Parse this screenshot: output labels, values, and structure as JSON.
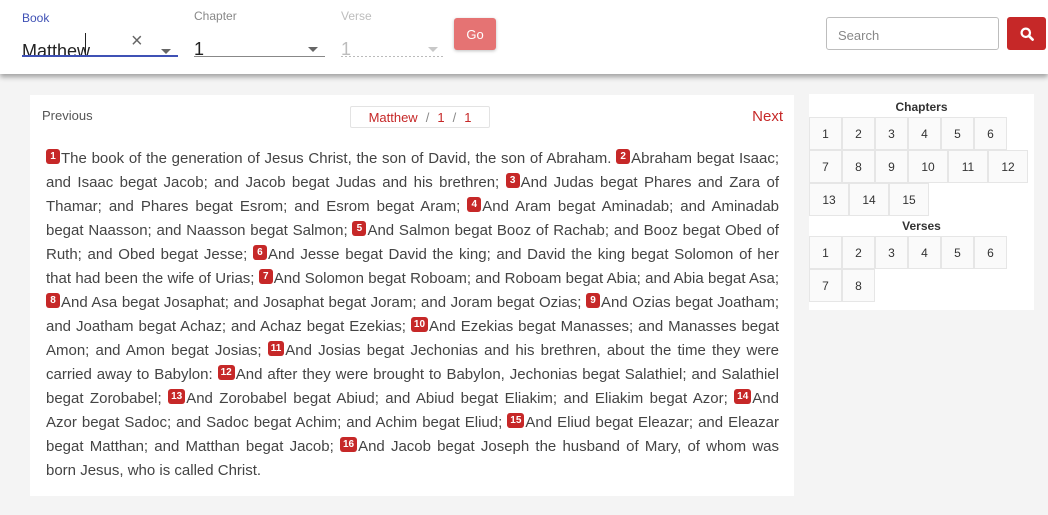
{
  "book_field": {
    "label": "Book",
    "value": "Matthew"
  },
  "chapter_field": {
    "label": "Chapter",
    "value": "1"
  },
  "verse_field": {
    "label": "Verse",
    "value": "1"
  },
  "go_label": "Go",
  "search": {
    "placeholder": "Search"
  },
  "nav": {
    "previous": "Previous",
    "next": "Next",
    "crumb": {
      "book": "Matthew",
      "sep1": "/",
      "chapter": "1",
      "sep2": "/",
      "verse": "1"
    }
  },
  "verses": [
    {
      "n": "1",
      "text": "The book of the generation of Jesus Christ, the son of David, the son of Abraham."
    },
    {
      "n": "2",
      "text": "Abraham begat Isaac; and Isaac begat Jacob; and Jacob begat Judas and his brethren;"
    },
    {
      "n": "3",
      "text": "And Judas begat Phares and Zara of Thamar; and Phares begat Esrom; and Esrom begat Aram;"
    },
    {
      "n": "4",
      "text": "And Aram begat Aminadab; and Aminadab begat Naasson; and Naasson begat Salmon;"
    },
    {
      "n": "5",
      "text": "And Salmon begat Booz of Rachab; and Booz begat Obed of Ruth; and Obed begat Jesse;"
    },
    {
      "n": "6",
      "text": "And Jesse begat David the king; and David the king begat Solomon of her that had been the wife of Urias;"
    },
    {
      "n": "7",
      "text": "And Solomon begat Roboam; and Roboam begat Abia; and Abia begat Asa;"
    },
    {
      "n": "8",
      "text": "And Asa begat Josaphat; and Josaphat begat Joram; and Joram begat Ozias;"
    },
    {
      "n": "9",
      "text": "And Ozias begat Joatham; and Joatham begat Achaz; and Achaz begat Ezekias;"
    },
    {
      "n": "10",
      "text": "And Ezekias begat Manasses; and Manasses begat Amon; and Amon begat Josias;"
    },
    {
      "n": "11",
      "text": "And Josias begat Jechonias and his brethren, about the time they were carried away to Babylon:"
    },
    {
      "n": "12",
      "text": "And after they were brought to Babylon, Jechonias begat Salathiel; and Salathiel begat Zorobabel;"
    },
    {
      "n": "13",
      "text": "And Zorobabel begat Abiud; and Abiud begat Eliakim; and Eliakim begat Azor;"
    },
    {
      "n": "14",
      "text": "And Azor begat Sadoc; and Sadoc begat Achim; and Achim begat Eliud;"
    },
    {
      "n": "15",
      "text": "And Eliud begat Eleazar; and Eleazar begat Matthan; and Matthan begat Jacob;"
    },
    {
      "n": "16",
      "text": "And Jacob begat Joseph the husband of Mary, of whom was born Jesus, who is called Christ."
    }
  ],
  "sidebar": {
    "chapters_title": "Chapters",
    "chapters": [
      "1",
      "2",
      "3",
      "4",
      "5",
      "6",
      "7",
      "8",
      "9",
      "10",
      "11",
      "12",
      "13",
      "14",
      "15"
    ],
    "verses_title": "Verses",
    "verses": [
      "1",
      "2",
      "3",
      "4",
      "5",
      "6",
      "7",
      "8"
    ]
  },
  "colors": {
    "accent": "#c62828",
    "go_button": "#e57373",
    "focus": "#3f51b5"
  },
  "icons": {
    "clear": "close-icon",
    "dropdown": "chevron-down-icon",
    "search": "search-icon"
  }
}
